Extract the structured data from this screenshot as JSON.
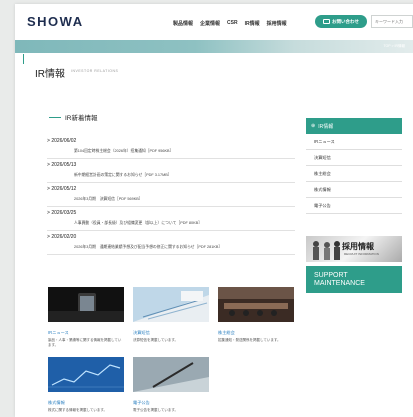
{
  "header": {
    "logo": "SHOWA",
    "nav": [
      "製品情報",
      "企業情報",
      "CSR",
      "IR情報",
      "採用情報"
    ],
    "contact_label": "お問い合わせ",
    "search_placeholder": "キーワード入力"
  },
  "breadcrumb": "TOP > IR情報",
  "page": {
    "title": "IR情報",
    "subtitle": "INVESTOR RELATIONS"
  },
  "news": {
    "heading": "IR新着情報",
    "items": [
      {
        "date": "2026/06/02",
        "text": "第104回定時株主総会（2026年）招集通知［PDF 956KB］"
      },
      {
        "date": "2026/05/13",
        "text": "新中期経営計画の策定に関するお知らせ［PDF 3.17MB］"
      },
      {
        "date": "2026/05/12",
        "text": "2026年3月期　決算短信［PDF 569KB］"
      },
      {
        "date": "2026/03/25",
        "text": "人事異動（役員・部長級）及び組織変更（部以上）について［PDF 80KB］"
      },
      {
        "date": "2026/02/20",
        "text": "2026年3月期　通期連結業績予想及び配当予想の修正に関するお知らせ［PDF 281KB］"
      }
    ]
  },
  "sidebar": {
    "heading": "IR情報",
    "items": [
      "IRニュース",
      "決算短信",
      "株主総会",
      "株式情報",
      "電子公告"
    ],
    "recruit_title": "採用情報",
    "recruit_sub": "RECRUIT INFORMATION",
    "support_line1": "SUPPORT",
    "support_line2": "MAINTENANCE"
  },
  "tiles": [
    {
      "title": "IRニュース",
      "desc": "製品・人事・業績等に関する情報を掲載しています。"
    },
    {
      "title": "決算短信",
      "desc": "決算短信を掲載しています。"
    },
    {
      "title": "株主総会",
      "desc": "招集通知・発送関係を掲載しています。"
    },
    {
      "title": "株式情報",
      "desc": "株式に関する情報を掲載しています。"
    },
    {
      "title": "電子公告",
      "desc": "電子公告を掲載しています。"
    }
  ],
  "colors": {
    "accent": "#2e9d8a",
    "link": "#2a7fc0"
  }
}
